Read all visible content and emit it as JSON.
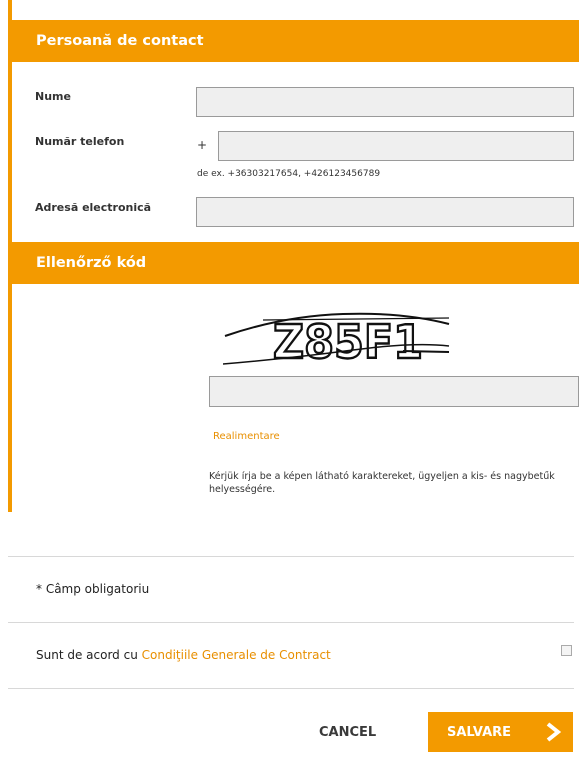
{
  "colors": {
    "accent": "#f39a00",
    "link": "#e88f00"
  },
  "contact_section": {
    "title": "Persoană de contact",
    "name_label": "Nume",
    "name_value": "",
    "phone_label": "Număr telefon",
    "phone_prefix": "+",
    "phone_value": "",
    "phone_hint": "de ex. +36303217654, +426123456789",
    "email_label": "Adresă electronică",
    "email_value": ""
  },
  "captcha_section": {
    "title": "Ellenőrző kód",
    "captcha_text": "Z85F1",
    "code_value": "",
    "reload_label": "Realimentare",
    "help_text": "Kérjük írja be a képen látható karaktereket, ügyeljen a kis- és nagybetűk helyességére."
  },
  "footer": {
    "required_note": "* Câmp obligatoriu",
    "terms_prefix": "Sunt de acord cu ",
    "terms_link": "Condiţiile Generale de Contract",
    "terms_checked": false,
    "cancel_label": "CANCEL",
    "save_label": "SALVARE",
    "save_icon": "chevron-right-icon"
  }
}
